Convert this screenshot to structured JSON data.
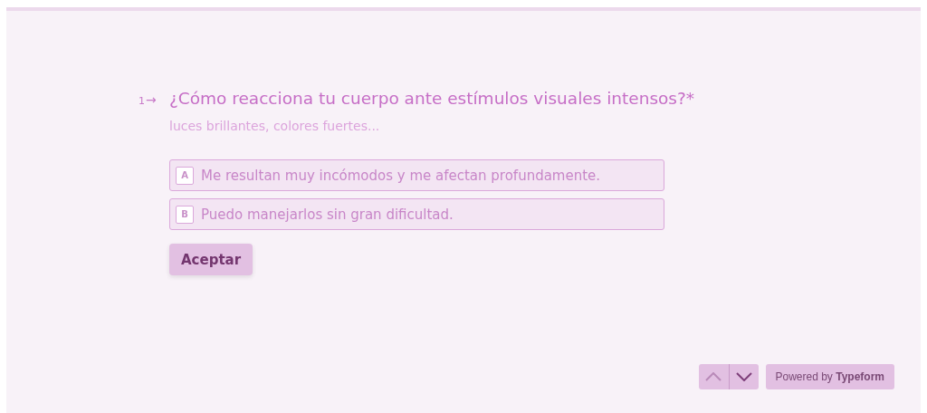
{
  "question": {
    "number": "1",
    "arrow": "→",
    "text": "¿Cómo reacciona tu cuerpo ante estímulos visuales intensos?*",
    "description": "luces brillantes, colores fuertes..."
  },
  "options": [
    {
      "key": "A",
      "label": "Me resultan muy incómodos y me afectan profundamente.",
      "selected": false
    },
    {
      "key": "B",
      "label": "Puedo manejarlos sin gran dificultad.",
      "selected": false
    }
  ],
  "submit": {
    "label": "Aceptar"
  },
  "nav": {
    "up_disabled": true,
    "down_disabled": false
  },
  "branding": "Powered by **Typeform**"
}
